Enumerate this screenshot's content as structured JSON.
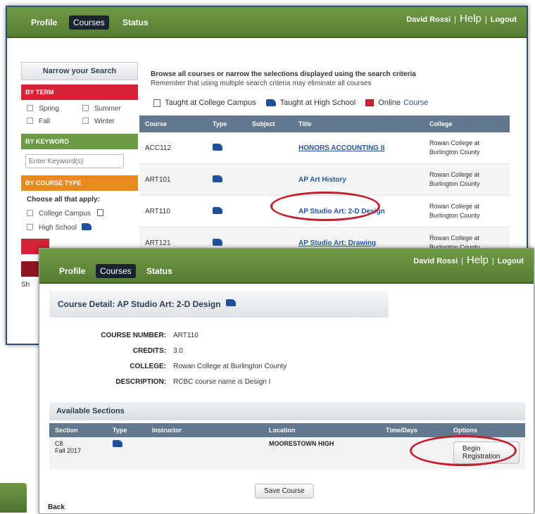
{
  "colors": {
    "green_bar": "#5f8a3b",
    "red": "#d42336",
    "orange": "#e98a1e",
    "link_blue": "#2356a3",
    "header_slate": "#62788e",
    "annotation_red": "#c41e2e"
  },
  "nav": {
    "tabs": [
      "Profile",
      "Courses",
      "Status"
    ],
    "active": "Courses"
  },
  "user": {
    "name": "David Rossi",
    "help": "Help",
    "logout": "Logout",
    "separator": "|"
  },
  "search_sidebar": {
    "title": "Narrow your Search",
    "by_term": {
      "header": "BY TERM",
      "options": [
        "Spring",
        "Summer",
        "Fall",
        "Winter"
      ]
    },
    "by_keyword": {
      "header": "BY KEYWORD",
      "placeholder": "Enter Keyword(s)"
    },
    "by_course_type": {
      "header": "BY COURSE TYPE",
      "prompt": "Choose all that apply:",
      "options": [
        "College Campus",
        "High School"
      ]
    },
    "truncated_label": "Sh"
  },
  "intro": {
    "line1": "Browse all courses or narrow the selections displayed using the search criteria",
    "line2": "Remember that using multiple search criteria may eliminate all courses"
  },
  "legend": {
    "college_campus": "Taught at College Campus",
    "high_school": "Taught at High School",
    "online": "Online",
    "online_suffix": "Course"
  },
  "icons": {
    "college": "building-icon",
    "high_school": "graduation-cap-icon",
    "online": "monitor-icon"
  },
  "course_table": {
    "headers": [
      "Course",
      "Type",
      "Subject",
      "Title",
      "College"
    ],
    "rows": [
      {
        "course": "ACC112",
        "title": "HONORS ACCOUNTING II",
        "college1": "Rowan College at",
        "college2": "Burlington County"
      },
      {
        "course": "ART101",
        "title": "AP Art History",
        "college1": "Rowan College at",
        "college2": "Burlington County"
      },
      {
        "course": "ART110",
        "title": "AP Studio Art: 2-D Design",
        "college1": "Rowan College at",
        "college2": "Burlington County"
      },
      {
        "course": "ART121",
        "title": "AP Studio Art: Drawing",
        "college1": "Rowan College at",
        "college2": "Burlington County"
      }
    ]
  },
  "course_detail": {
    "heading": "Course Detail: AP Studio Art: 2-D Design",
    "fields": [
      {
        "label": "COURSE NUMBER:",
        "value": "ART110"
      },
      {
        "label": "CREDITS:",
        "value": "3.0"
      },
      {
        "label": "COLLEGE:",
        "value": "Rowan College at Burlington County"
      },
      {
        "label": "DESCRIPTION:",
        "value": "RCBC course name is Design I"
      }
    ]
  },
  "sections": {
    "title": "Available Sections",
    "headers": [
      "Section",
      "Type",
      "Instructor",
      "Location",
      "Time/Days",
      "Options"
    ],
    "rows": [
      {
        "section": "C8",
        "term": "Fall 2017",
        "instructor": "",
        "location": "MOORESTOWN HIGH",
        "time_days": "",
        "action": "Begin Registration"
      }
    ]
  },
  "buttons": {
    "save_course": "Save Course",
    "back": "Back"
  }
}
